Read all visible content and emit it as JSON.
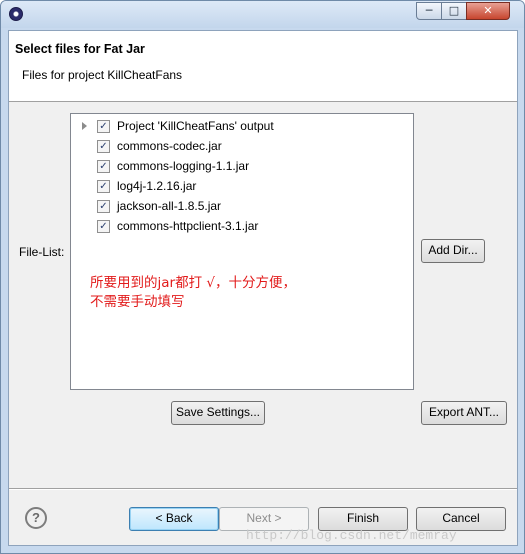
{
  "window": {
    "min_symbol": "─",
    "max_symbol": "□",
    "close_symbol": "✕"
  },
  "header": {
    "title": "Select files for Fat Jar",
    "subtitle": "Files for project KillCheatFans"
  },
  "file_list": {
    "label": "File-List:",
    "items": [
      {
        "label": "Project 'KillCheatFans' output",
        "checked": true
      },
      {
        "label": "commons-codec.jar",
        "checked": true
      },
      {
        "label": "commons-logging-1.1.jar",
        "checked": true
      },
      {
        "label": "log4j-1.2.16.jar",
        "checked": true
      },
      {
        "label": "jackson-all-1.8.5.jar",
        "checked": true
      },
      {
        "label": "commons-httpclient-3.1.jar",
        "checked": true
      }
    ],
    "check_mark": "✓"
  },
  "annotation": {
    "line1": "所要用到的jar都打 √，十分方便，",
    "line2": "不需要手动填写",
    "color": "#e21b1b"
  },
  "buttons": {
    "add_dir": "Add Dir...",
    "save_settings": "Save Settings...",
    "export_ant": "Export ANT...",
    "back": "< Back",
    "next": "Next >",
    "finish": "Finish",
    "cancel": "Cancel"
  },
  "help": {
    "symbol": "?"
  },
  "watermark": "http://blog.csdn.net/memray"
}
